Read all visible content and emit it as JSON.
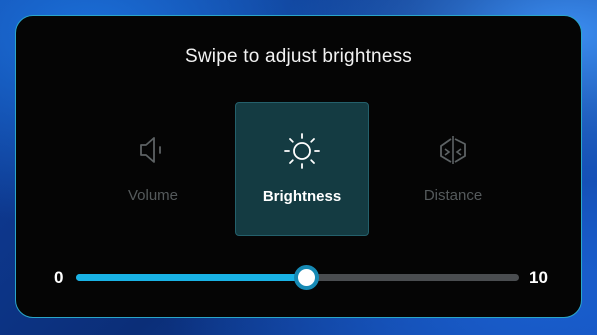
{
  "title": "Swipe to adjust brightness",
  "modes": [
    {
      "label": "Volume",
      "icon": "speaker-icon",
      "selected": false
    },
    {
      "label": "Brightness",
      "icon": "sun-icon",
      "selected": true
    },
    {
      "label": "Distance",
      "icon": "distance-icon",
      "selected": false
    }
  ],
  "slider": {
    "min_label": "0",
    "max_label": "10",
    "min": 0,
    "max": 10,
    "value": 5.2
  },
  "colors": {
    "accent": "#19b3e6",
    "panel_border": "#2aa6c9",
    "selected_bg": "#143b42",
    "panel_bg": "#050505"
  }
}
